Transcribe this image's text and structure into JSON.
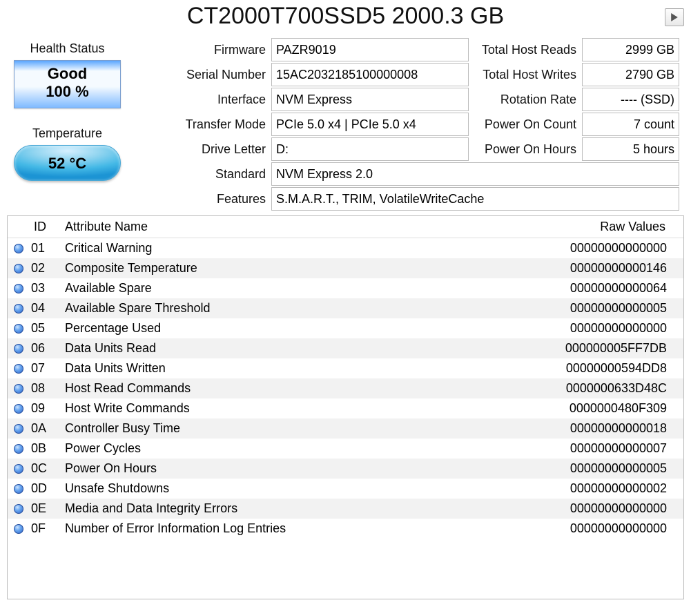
{
  "title": "CT2000T700SSD5 2000.3 GB",
  "left": {
    "health_label": "Health Status",
    "health_text": "Good",
    "health_pct": "100 %",
    "temp_label": "Temperature",
    "temp_value": "52 °C"
  },
  "info": {
    "firmware_label": "Firmware",
    "firmware": "PAZR9019",
    "serial_label": "Serial Number",
    "serial": "15AC2032185100000008",
    "interface_label": "Interface",
    "interface": "NVM Express",
    "transfer_label": "Transfer Mode",
    "transfer": "PCIe 5.0 x4 | PCIe 5.0 x4",
    "drive_label": "Drive Letter",
    "drive": "D:",
    "standard_label": "Standard",
    "standard": "NVM Express 2.0",
    "features_label": "Features",
    "features": "S.M.A.R.T., TRIM, VolatileWriteCache",
    "reads_label": "Total Host Reads",
    "reads": "2999 GB",
    "writes_label": "Total Host Writes",
    "writes": "2790 GB",
    "rotation_label": "Rotation Rate",
    "rotation": "---- (SSD)",
    "poc_label": "Power On Count",
    "poc": "7 count",
    "poh_label": "Power On Hours",
    "poh": "5 hours"
  },
  "table": {
    "col_id": "ID",
    "col_name": "Attribute Name",
    "col_raw": "Raw Values",
    "rows": [
      {
        "id": "01",
        "name": "Critical Warning",
        "raw": "00000000000000"
      },
      {
        "id": "02",
        "name": "Composite Temperature",
        "raw": "00000000000146"
      },
      {
        "id": "03",
        "name": "Available Spare",
        "raw": "00000000000064"
      },
      {
        "id": "04",
        "name": "Available Spare Threshold",
        "raw": "00000000000005"
      },
      {
        "id": "05",
        "name": "Percentage Used",
        "raw": "00000000000000"
      },
      {
        "id": "06",
        "name": "Data Units Read",
        "raw": "000000005FF7DB"
      },
      {
        "id": "07",
        "name": "Data Units Written",
        "raw": "00000000594DD8"
      },
      {
        "id": "08",
        "name": "Host Read Commands",
        "raw": "0000000633D48C"
      },
      {
        "id": "09",
        "name": "Host Write Commands",
        "raw": "0000000480F309"
      },
      {
        "id": "0A",
        "name": "Controller Busy Time",
        "raw": "00000000000018"
      },
      {
        "id": "0B",
        "name": "Power Cycles",
        "raw": "00000000000007"
      },
      {
        "id": "0C",
        "name": "Power On Hours",
        "raw": "00000000000005"
      },
      {
        "id": "0D",
        "name": "Unsafe Shutdowns",
        "raw": "00000000000002"
      },
      {
        "id": "0E",
        "name": "Media and Data Integrity Errors",
        "raw": "00000000000000"
      },
      {
        "id": "0F",
        "name": "Number of Error Information Log Entries",
        "raw": "00000000000000"
      }
    ]
  }
}
